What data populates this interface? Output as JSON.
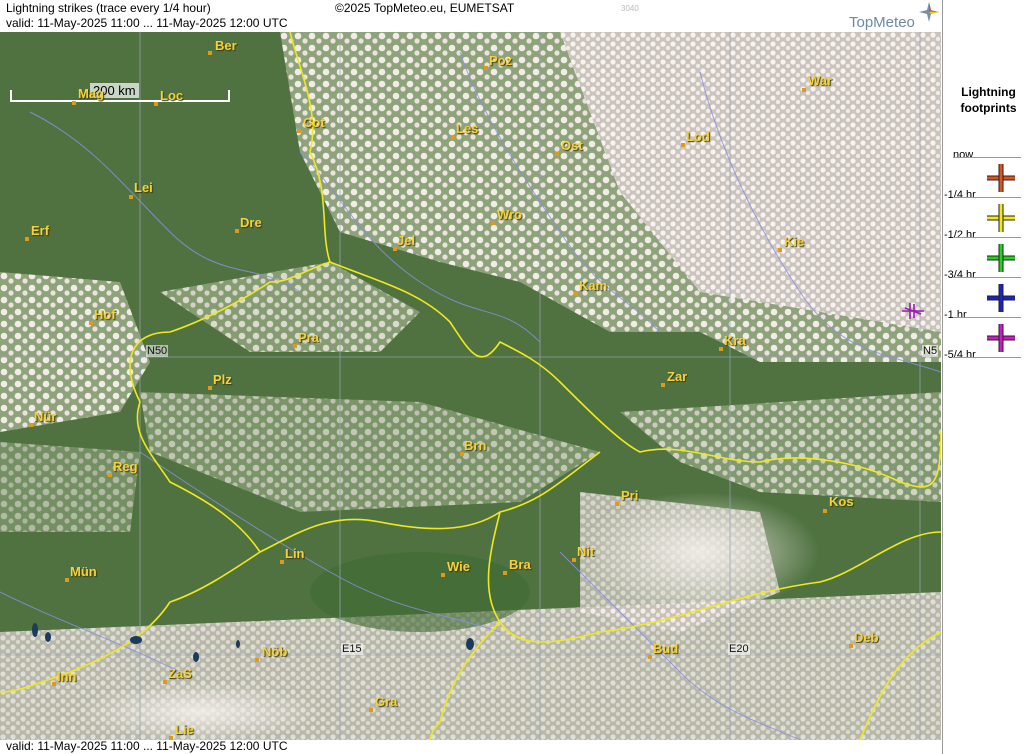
{
  "header": {
    "title": "Lightning strikes (trace every 1/4 hour)",
    "valid": "valid:  11-May-2025 11:00 ... 11-May-2025 12:00 UTC",
    "copyright": "©2025 TopMeteo.eu, EUMETSAT",
    "code": "3040",
    "logo": "TopMeteo"
  },
  "footer": {
    "valid": "valid:  11-May-2025 11:00 ... 11-May-2025 12:00 UTC"
  },
  "scale": {
    "label": "200 km"
  },
  "grid_labels": {
    "n50_left": "N50",
    "n50_right": "N5",
    "e15": "E15",
    "e20": "E20"
  },
  "cities": [
    "Ber",
    "Poz",
    "War",
    "Mag",
    "Loc",
    "Cot",
    "Les",
    "Ost",
    "Lod",
    "Lei",
    "Erf",
    "Dre",
    "Wro",
    "Jel",
    "Kie",
    "Kam",
    "Hof",
    "Pra",
    "Kra",
    "Plz",
    "Zar",
    "Nür",
    "Brn",
    "Reg",
    "Kos",
    "Pri",
    "Lin",
    "Nit",
    "Mün",
    "Wie",
    "Bra",
    "Deb",
    "Bud",
    "Nöb",
    "Inn",
    "ZaS",
    "Gra",
    "Lie"
  ],
  "legend": {
    "title_line1": "Lightning",
    "title_line2": "footprints",
    "items": [
      {
        "label": "now",
        "color": ""
      },
      {
        "label": "-1/4 hr",
        "color": "#e0541c"
      },
      {
        "label": "-1/2 hr",
        "color": "#f2e81a"
      },
      {
        "label": "-3/4 hr",
        "color": "#22d41e"
      },
      {
        "label": "-1 hr",
        "color": "#1a22c8"
      },
      {
        "label": "-5/4 hr",
        "color": "#d01ac8"
      }
    ]
  },
  "strikes": [
    {
      "age": "-1 hr",
      "color": "#9a1ab0"
    }
  ]
}
